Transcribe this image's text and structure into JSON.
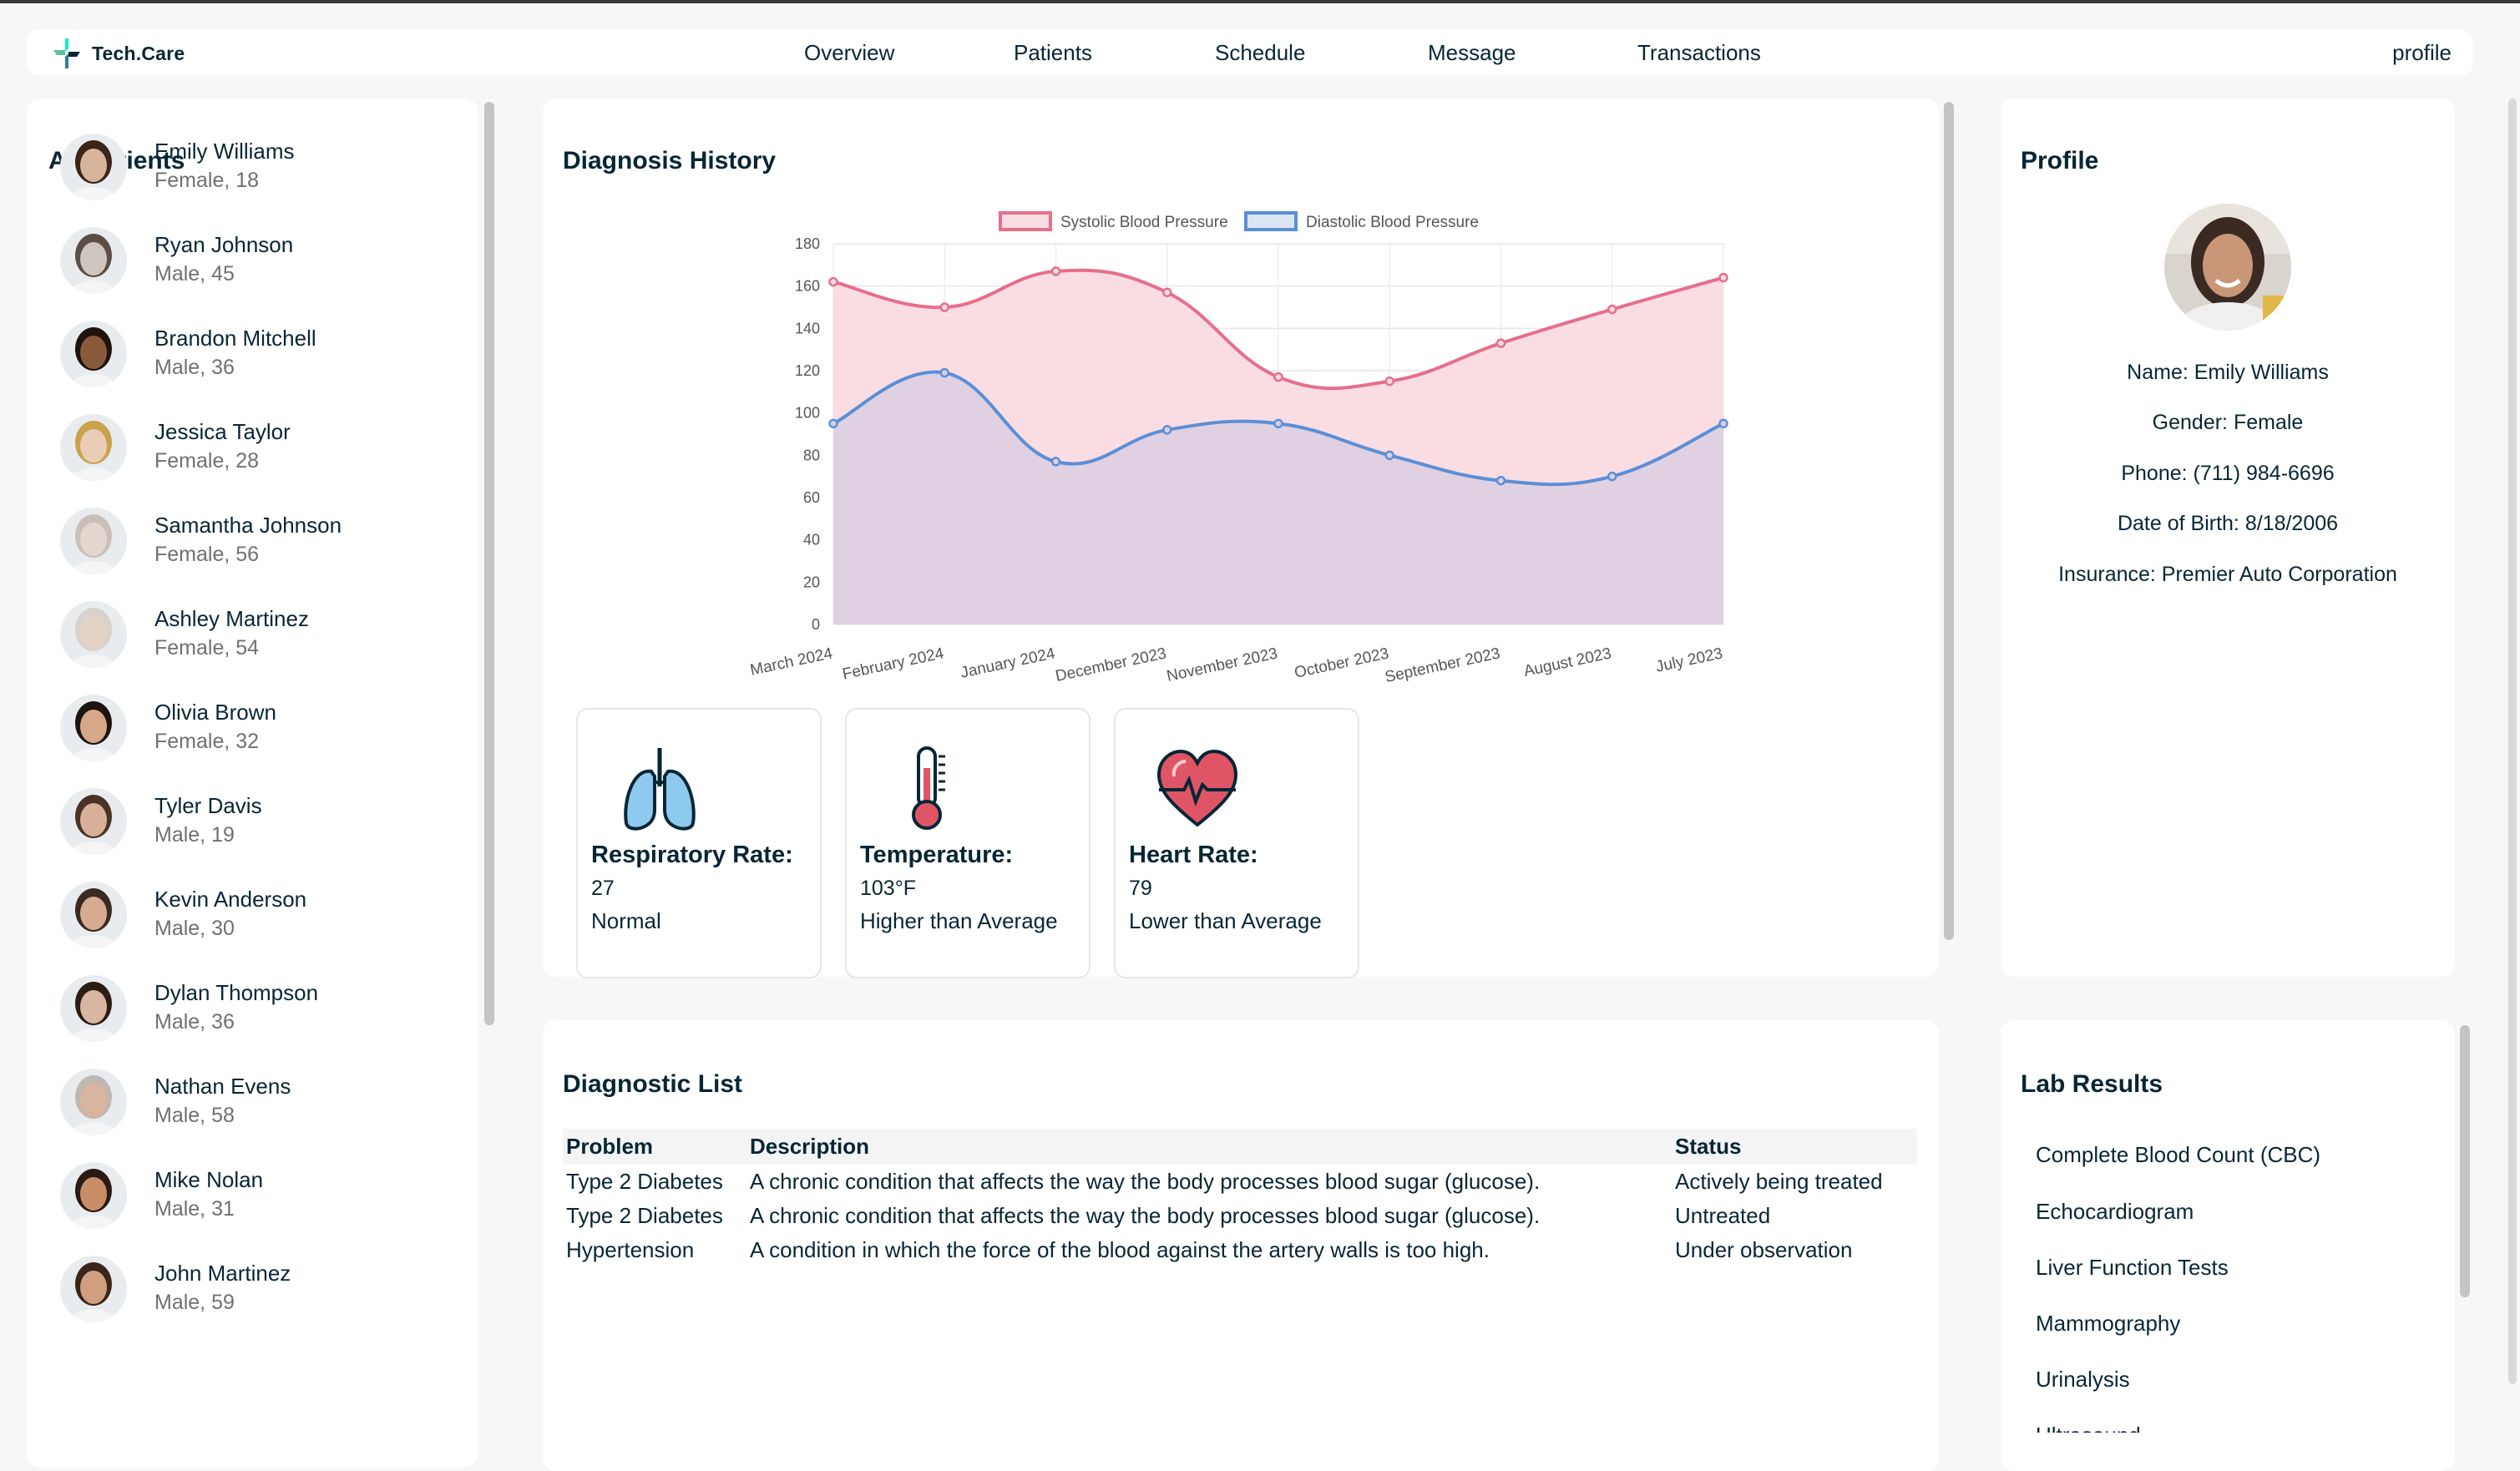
{
  "app": {
    "logo_text": "Tech.Care",
    "nav": [
      "Overview",
      "Patients",
      "Schedule",
      "Message",
      "Transactions"
    ],
    "profile_link": "profile"
  },
  "patients": {
    "title": "All Patients",
    "items": [
      {
        "name": "Emily Williams",
        "meta": "Female, 18"
      },
      {
        "name": "Ryan Johnson",
        "meta": "Male, 45"
      },
      {
        "name": "Brandon Mitchell",
        "meta": "Male, 36"
      },
      {
        "name": "Jessica Taylor",
        "meta": "Female, 28"
      },
      {
        "name": "Samantha Johnson",
        "meta": "Female, 56"
      },
      {
        "name": "Ashley Martinez",
        "meta": "Female, 54"
      },
      {
        "name": "Olivia Brown",
        "meta": "Female, 32"
      },
      {
        "name": "Tyler Davis",
        "meta": "Male, 19"
      },
      {
        "name": "Kevin Anderson",
        "meta": "Male, 30"
      },
      {
        "name": "Dylan Thompson",
        "meta": "Male, 36"
      },
      {
        "name": "Nathan Evens",
        "meta": "Male, 58"
      },
      {
        "name": "Mike Nolan",
        "meta": "Male, 31"
      },
      {
        "name": "John Martinez",
        "meta": "Male, 59"
      }
    ]
  },
  "diagnosis_history": {
    "title": "Diagnosis History"
  },
  "chart_data": {
    "type": "area",
    "categories": [
      "March 2024",
      "February 2024",
      "January 2024",
      "December 2023",
      "November 2023",
      "October 2023",
      "September 2023",
      "August 2023",
      "July 2023"
    ],
    "series": [
      {
        "name": "Systolic Blood Pressure",
        "values": [
          162,
          150,
          167,
          157,
          117,
          115,
          133,
          149,
          164
        ],
        "color": "#e66f8a",
        "fill": "#f9dde3"
      },
      {
        "name": "Diastolic Blood Pressure",
        "values": [
          95,
          119,
          77,
          92,
          95,
          80,
          68,
          70,
          95
        ],
        "color": "#5b8fd6",
        "fill": "#dccfe2"
      }
    ],
    "ylim": [
      0,
      180
    ],
    "yticks": [
      0,
      20,
      40,
      60,
      80,
      100,
      120,
      140,
      160,
      180
    ],
    "legend": "top-center",
    "grid": true
  },
  "vitals": [
    {
      "title": "Respiratory Rate:",
      "value": "27",
      "note": "Normal",
      "icon": "lungs-icon"
    },
    {
      "title": "Temperature:",
      "value": "103°F",
      "note": "Higher than Average",
      "icon": "thermometer-icon"
    },
    {
      "title": "Heart Rate:",
      "value": "79",
      "note": "Lower than Average",
      "icon": "heart-icon"
    }
  ],
  "profile": {
    "title": "Profile",
    "name": "Name: Emily Williams",
    "gender": "Gender: Female",
    "phone": "Phone: (711) 984-6696",
    "dob": "Date of Birth: 8/18/2006",
    "insurance": "Insurance: Premier Auto Corporation"
  },
  "diagnostic_list": {
    "title": "Diagnostic List",
    "headers": [
      "Problem",
      "Description",
      "Status"
    ],
    "rows": [
      [
        "Type 2 Diabetes",
        "A chronic condition that affects the way the body processes blood sugar (glucose).",
        "Actively being treated"
      ],
      [
        "Type 2 Diabetes",
        "A chronic condition that affects the way the body processes blood sugar (glucose).",
        "Untreated"
      ],
      [
        "Hypertension",
        "A condition in which the force of the blood against the artery walls is too high.",
        "Under observation"
      ]
    ]
  },
  "lab_results": {
    "title": "Lab Results",
    "items": [
      "Complete Blood Count (CBC)",
      "Echocardiogram",
      "Liver Function Tests",
      "Mammography",
      "Urinalysis",
      "Ultrasound"
    ]
  }
}
